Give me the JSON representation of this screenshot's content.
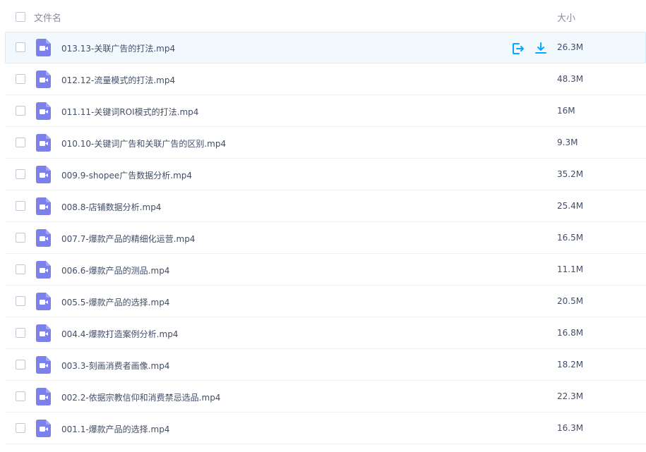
{
  "header": {
    "name_label": "文件名",
    "size_label": "大小"
  },
  "colors": {
    "accent": "#06a7ff",
    "video_icon": "#7b80eb",
    "hover_bg": "#f2f9fe"
  },
  "files": [
    {
      "name": "013.13-关联广告的打法.mp4",
      "size": "26.3M",
      "icon": "video-file-icon"
    },
    {
      "name": "012.12-流量模式的打法.mp4",
      "size": "48.3M",
      "icon": "video-file-icon"
    },
    {
      "name": "011.11-关键词ROI模式的打法.mp4",
      "size": "16M",
      "icon": "video-file-icon"
    },
    {
      "name": "010.10-关键词广告和关联广告的区别.mp4",
      "size": "9.3M",
      "icon": "video-file-icon"
    },
    {
      "name": "009.9-shopee广告数据分析.mp4",
      "size": "35.2M",
      "icon": "video-file-icon"
    },
    {
      "name": "008.8-店铺数据分析.mp4",
      "size": "25.4M",
      "icon": "video-file-icon"
    },
    {
      "name": "007.7-爆款产品的精细化运营.mp4",
      "size": "16.5M",
      "icon": "video-file-icon"
    },
    {
      "name": "006.6-爆款产品的测品.mp4",
      "size": "11.1M",
      "icon": "video-file-icon"
    },
    {
      "name": "005.5-爆款产品的选择.mp4",
      "size": "20.5M",
      "icon": "video-file-icon"
    },
    {
      "name": "004.4-爆款打造案例分析.mp4",
      "size": "16.8M",
      "icon": "video-file-icon"
    },
    {
      "name": "003.3-刻画消费者画像.mp4",
      "size": "18.2M",
      "icon": "video-file-icon"
    },
    {
      "name": "002.2-依据宗教信仰和消费禁忌选品.mp4",
      "size": "22.3M",
      "icon": "video-file-icon"
    },
    {
      "name": "001.1-爆款产品的选择.mp4",
      "size": "16.3M",
      "icon": "video-file-icon"
    }
  ]
}
